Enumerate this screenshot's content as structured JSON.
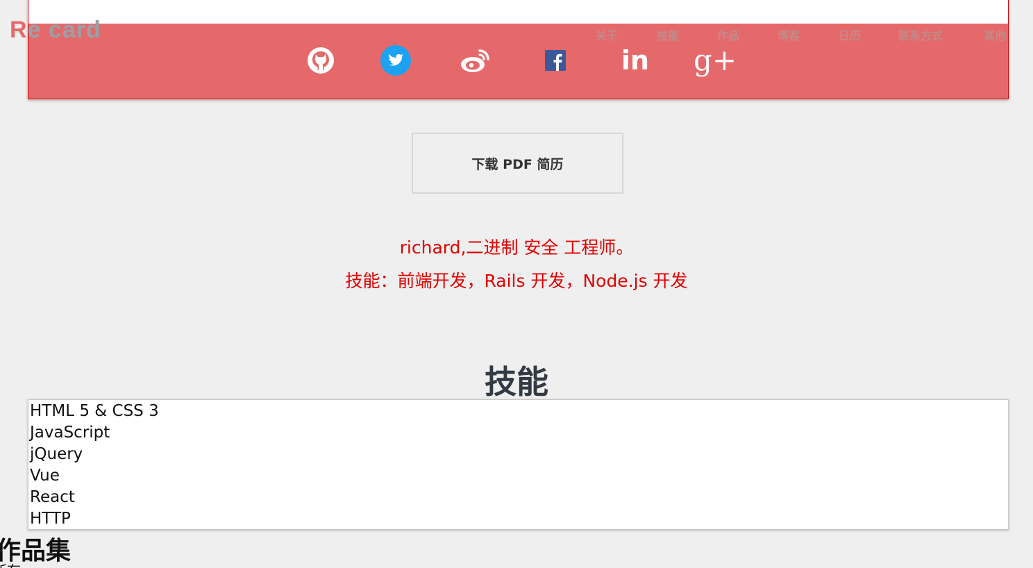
{
  "header": {
    "logo": {
      "first": "R",
      "rest": "e card",
      "overlap_char": "●"
    },
    "nav": [
      "关于",
      "技能",
      "作品",
      "博客",
      "日历",
      "联系方式",
      "其他"
    ]
  },
  "social": [
    {
      "icon": "github-icon"
    },
    {
      "icon": "twitter-icon"
    },
    {
      "icon": "weibo-icon"
    },
    {
      "icon": "facebook-icon"
    },
    {
      "icon": "linkedin-icon",
      "text": "in"
    },
    {
      "icon": "google-plus-icon",
      "text": "g+"
    }
  ],
  "download": {
    "label": "下载 PDF 简历"
  },
  "intro": {
    "line1": "richard,二进制 安全 工程师。",
    "line2": "技能：前端开发，Rails 开发，Node.js 开发"
  },
  "skills": {
    "title": "技能",
    "items": [
      "HTML 5 & CSS 3",
      "JavaScript",
      "jQuery",
      "Vue",
      "React",
      "HTTP"
    ]
  },
  "works": {
    "title": "作品集",
    "subtitle": "所有"
  },
  "colors": {
    "header_red": "#e5696a",
    "intro_red": "#e10000",
    "twitter_blue": "#1da1f2",
    "facebook_blue": "#3b5998",
    "background": "#efefef"
  }
}
